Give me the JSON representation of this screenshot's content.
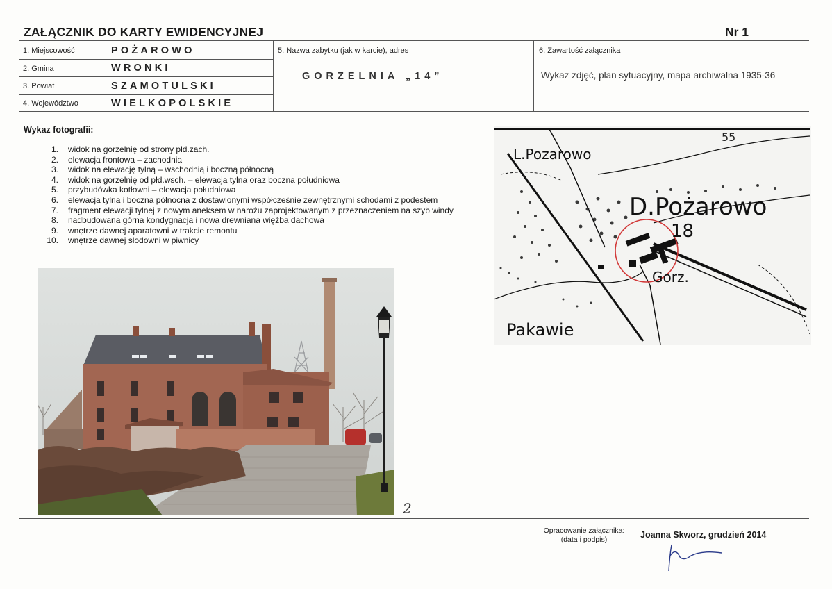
{
  "header": {
    "title": "ZAŁĄCZNIK DO KARTY EWIDENCYJNEJ",
    "number": "Nr 1"
  },
  "fields": {
    "locality_label": "1. Miejscowość",
    "locality_value": "POŻAROWO",
    "commune_label": "2. Gmina",
    "commune_value": "WRONKI",
    "county_label": "3. Powiat",
    "county_value": "SZAMOTULSKI",
    "voivodeship_label": "4. Województwo",
    "voivodeship_value": "WIELKOPOLSKIE",
    "name_label": "5. Nazwa zabytku (jak w karcie), adres",
    "name_value": "GORZELNIA „14”",
    "contents_label": "6. Zawartość załącznika",
    "contents_value": "Wykaz zdjęć,  plan sytuacyjny, mapa archiwalna 1935-36"
  },
  "photos": {
    "heading": "Wykaz fotografii:",
    "items": [
      {
        "num": "1.",
        "text": "widok na gorzelnię od strony płd.zach."
      },
      {
        "num": "2.",
        "text": "elewacja frontowa – zachodnia"
      },
      {
        "num": "3.",
        "text": "widok na elewację tylną – wschodnią i boczną północną"
      },
      {
        "num": "4.",
        "text": "widok na gorzelnię od płd.wsch. – elewacja tylna oraz boczna południowa"
      },
      {
        "num": "5.",
        "text": "przybudówka kotłowni – elewacja południowa"
      },
      {
        "num": "6.",
        "text": "elewacja tylna i boczna północna z dostawionymi współcześnie zewnętrznymi schodami z podestem"
      },
      {
        "num": "7.",
        "text": "fragment elewacji tylnej z nowym aneksem w narożu zaprojektowanym z przeznaczeniem na szyb windy"
      },
      {
        "num": "8.",
        "text": "nadbudowana górna kondygnacja i nowa drewniana więźba dachowa"
      },
      {
        "num": "9.",
        "text": "wnętrze dawnej aparatowni w trakcie remontu"
      },
      {
        "num": "10.",
        "text": "wnętrze dawnej słodowni w piwnicy"
      }
    ],
    "photo_number": "2"
  },
  "map": {
    "label_lpozarowo": "L.Pozarowo",
    "label_dpozarowo": "D.Pożarowo",
    "label_18": "18",
    "label_gorz": "Gorz.",
    "label_pakawie": "Pakawie",
    "label_55": "55"
  },
  "footer": {
    "prepared_label": "Opracowanie załącznika:",
    "prepared_sublabel": "(data i podpis)",
    "author": "Joanna Skworz, grudzień 2014"
  }
}
